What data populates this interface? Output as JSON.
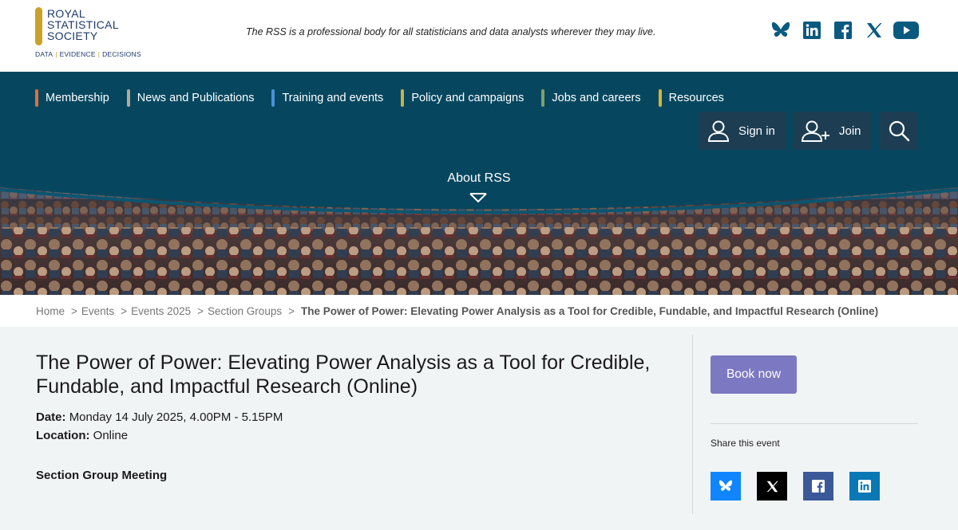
{
  "logo": {
    "line1": "ROYAL",
    "line2": "STATISTICAL",
    "line3": "SOCIETY",
    "tag1": "DATA",
    "tag2": "EVIDENCE",
    "tag3": "DECISIONS"
  },
  "tagline": "The RSS is a professional body for all statisticians and data analysts wherever they may live.",
  "social": [
    "bluesky-icon",
    "linkedin-icon",
    "facebook-icon",
    "x-icon",
    "youtube-icon"
  ],
  "nav": {
    "items": [
      {
        "label": "Membership",
        "color": "#e0703a"
      },
      {
        "label": "News and Publications",
        "color": "#b5a99a"
      },
      {
        "label": "Training and events",
        "color": "#4a90d9"
      },
      {
        "label": "Policy and campaigns",
        "color": "#c9b04a"
      },
      {
        "label": "Jobs and careers",
        "color": "#7fa06a"
      },
      {
        "label": "Resources",
        "color": "#d9b23a"
      }
    ],
    "signin": "Sign in",
    "join": "Join",
    "about": "About RSS"
  },
  "breadcrumb": {
    "home": "Home",
    "events": "Events",
    "events2025": "Events 2025",
    "section_groups": "Section Groups",
    "current": "The Power of Power: Elevating Power Analysis as a Tool for Credible, Fundable, and Impactful Research (Online)",
    "sep": ">"
  },
  "event": {
    "title": "The Power of Power: Elevating Power Analysis as a Tool for Credible, Fundable, and Impactful Research (Online)",
    "date_label": "Date:",
    "date_value": "Monday 14 July 2025, 4.00PM - 5.15PM",
    "location_label": "Location:",
    "location_value": "Online",
    "category": "Section Group Meeting"
  },
  "sidebar": {
    "book_label": "Book now",
    "share_label": "Share this event",
    "share_buttons": [
      {
        "icon": "bluesky-icon",
        "color": "#1185fe"
      },
      {
        "icon": "x-icon",
        "color": "#000000"
      },
      {
        "icon": "facebook-icon",
        "color": "#3b5998"
      },
      {
        "icon": "linkedin-icon",
        "color": "#0a78b5"
      }
    ]
  },
  "colors": {
    "nav_bg": "#06475f",
    "book_button": "#7c78c2",
    "brand_gold": "#c9a227",
    "brand_navy": "#1f3a6b"
  }
}
